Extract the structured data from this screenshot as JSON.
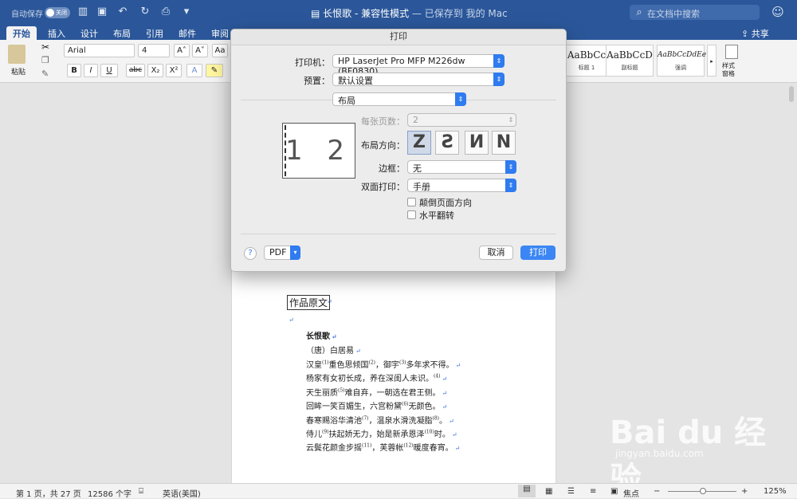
{
  "titlebar": {
    "autosave_label": "自动保存",
    "autosave_state": "关闭",
    "doc_title": "长恨歌",
    "doc_mode": " - 兼容性模式",
    "doc_status": " — 已保存到 我的 Mac",
    "search_placeholder": "在文档中搜索"
  },
  "tabs": [
    "开始",
    "插入",
    "设计",
    "布局",
    "引用",
    "邮件",
    "审阅"
  ],
  "share_label": "共享",
  "ribbon": {
    "paste_label": "粘贴",
    "font_name": "Arial",
    "font_size": "4",
    "styles": [
      {
        "preview": "AaBbCc",
        "name": "标题 1"
      },
      {
        "preview": "AaBbCcD",
        "name": "副标题"
      },
      {
        "preview": "AaBbCcDdEe",
        "name": "强调"
      }
    ],
    "styles_pane_label": "样式\n窗格"
  },
  "document": {
    "heading": "作品原文",
    "poem_title": "长恨歌",
    "poem_author": "（唐）白居易",
    "lines": [
      {
        "text": "汉皇",
        "n1": "(1)",
        "mid": "重色思倾国",
        "n2": "(2)",
        "tail": "，御宇",
        "n3": "(3)",
        "end": "多年求不得。"
      },
      {
        "text": "杨家有女初长成，养在深闺人未识。",
        "n1": "(4)"
      },
      {
        "text": "天生丽质",
        "n1": "(5)",
        "tail": "难自弃，一朝选在君王侧。"
      },
      {
        "text": "回眸一笑百媚生，六宫粉黛",
        "n1": "(6)",
        "tail": "无颜色。"
      },
      {
        "text": "春寒赐浴华清池",
        "n1": "(7)",
        "tail": "，温泉水滑洗凝脂",
        "n2": "(8)",
        "end": "。"
      },
      {
        "text": "侍儿",
        "n1": "(9)",
        "tail": "扶起娇无力，始是新承恩泽",
        "n2": "(10)",
        "end": "时。"
      },
      {
        "text": "云鬓花颜金步摇",
        "n1": "(11)",
        "tail": "，芙蓉帐",
        "n2": "(12)",
        "end": "暖度春宵。"
      }
    ]
  },
  "dialog": {
    "title": "打印",
    "printer_label": "打印机：",
    "printer_value": "HP LaserJet Pro MFP M226dw (BF0830)",
    "preset_label": "预置：",
    "preset_value": "默认设置",
    "section_value": "布局",
    "pages_per_sheet_label": "每张页数：",
    "pages_per_sheet_value": "2",
    "preview_text": "1 2",
    "layout_direction_label": "布局方向：",
    "directions": [
      "Z",
      "S",
      "N",
      "N"
    ],
    "border_label": "边框：",
    "border_value": "无",
    "duplex_label": "双面打印：",
    "duplex_value": "手册",
    "reverse_orientation_label": "颠倒页面方向",
    "flip_horizontal_label": "水平翻转",
    "help_label": "?",
    "pdf_label": "PDF",
    "cancel_label": "取消",
    "print_label": "打印"
  },
  "statusbar": {
    "page": "第 1 页，共 27 页",
    "words": "12586 个字",
    "language": "英语(美国)",
    "focus_label": "焦点",
    "zoom": "125%"
  },
  "watermark": {
    "brand": "Bai du 经验",
    "url": "jingyan.baidu.com"
  }
}
